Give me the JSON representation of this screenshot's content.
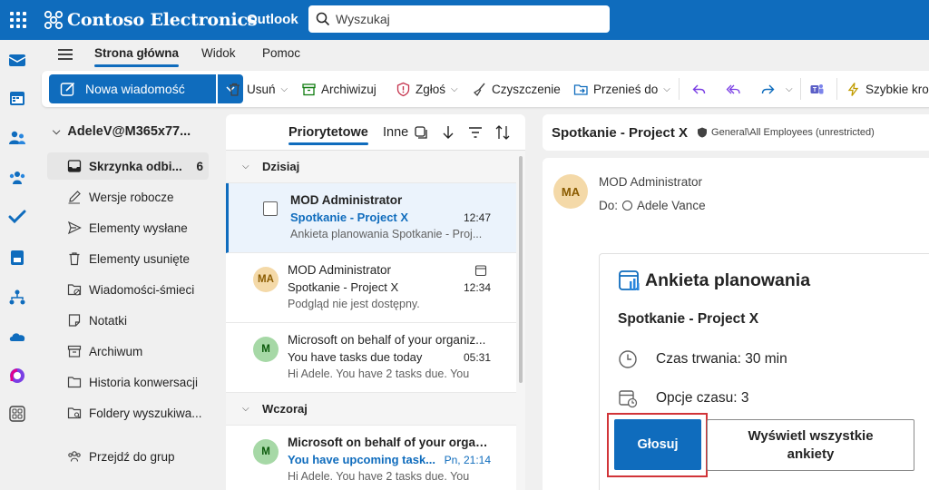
{
  "topbar": {
    "brand": "Contoso Electronics",
    "app": "Outlook",
    "search_placeholder": "Wyszukaj",
    "colors": {
      "topbar": "#0f6cbd",
      "accent": "#0f6cbd"
    }
  },
  "rail": {
    "items": [
      "mail-icon",
      "calendar-icon",
      "people-icon",
      "groups-icon",
      "todo-icon",
      "notes-icon",
      "org-icon",
      "onedrive-icon",
      "viva-icon",
      "more-apps-icon"
    ]
  },
  "ribbon": {
    "tabs": [
      "Strona główna",
      "Widok",
      "Pomoc"
    ],
    "active_tab": "Strona główna"
  },
  "toolbar": {
    "new_mail": "Nowa wiadomość",
    "delete": "Usuń",
    "archive": "Archiwizuj",
    "report": "Zgłoś",
    "sweep": "Czyszczenie",
    "move": "Przenieś do",
    "quick_steps": "Szybkie kro"
  },
  "folders": {
    "account": "AdeleV@M365x77...",
    "items": [
      {
        "label": "Skrzynka odbi...",
        "count": "6",
        "icon": "inbox-icon"
      },
      {
        "label": "Wersje robocze",
        "icon": "drafts-icon"
      },
      {
        "label": "Elementy wysłane",
        "icon": "sent-icon"
      },
      {
        "label": "Elementy usunięte",
        "icon": "trash-icon"
      },
      {
        "label": "Wiadomości-śmieci",
        "icon": "junk-icon"
      },
      {
        "label": "Notatki",
        "icon": "notes-icon"
      },
      {
        "label": "Archiwum",
        "icon": "archive-icon"
      },
      {
        "label": "Historia konwersacji",
        "icon": "folder-icon"
      },
      {
        "label": "Foldery wyszukiwa...",
        "icon": "search-folder-icon"
      }
    ],
    "groups_link": "Przejdź do grup"
  },
  "message_list": {
    "tabs": [
      "Priorytetowe",
      "Inne"
    ],
    "groups": [
      "Dzisiaj",
      "Wczoraj"
    ],
    "messages": [
      {
        "sender": "MOD Administrator",
        "subject": "Spotkanie - Project X",
        "time": "12:47",
        "preview": "Ankieta planowania Spotkanie - Proj..."
      },
      {
        "sender": "MOD Administrator",
        "subject": "Spotkanie - Project X",
        "time": "12:34",
        "preview": "Podgląd nie jest dostępny.",
        "avatar": "MA"
      },
      {
        "sender": "Microsoft on behalf of your organiz...",
        "subject": "You have tasks due today",
        "time": "05:31",
        "preview": "Hi Adele. You have 2 tasks due. You",
        "avatar": "M"
      },
      {
        "sender": "Microsoft on behalf of your organi...",
        "subject": "You have upcoming task...",
        "time": "Pn, 21:14",
        "preview": "Hi Adele. You have 2 tasks due. You",
        "avatar": "M"
      }
    ]
  },
  "reading": {
    "subject": "Spotkanie - Project X",
    "sensitivity": "General\\All Employees (unrestricted)",
    "sender": "MOD Administrator",
    "avatar": "MA",
    "to_label": "Do:",
    "to_name": "Adele Vance",
    "poll": {
      "title": "Ankieta planowania",
      "meeting": "Spotkanie - Project X",
      "duration": "Czas trwania: 30 min",
      "options": "Opcje czasu: 3",
      "vote_button": "Głosuj",
      "view_all_button": "Wyświetl wszystkie ankiety"
    }
  }
}
